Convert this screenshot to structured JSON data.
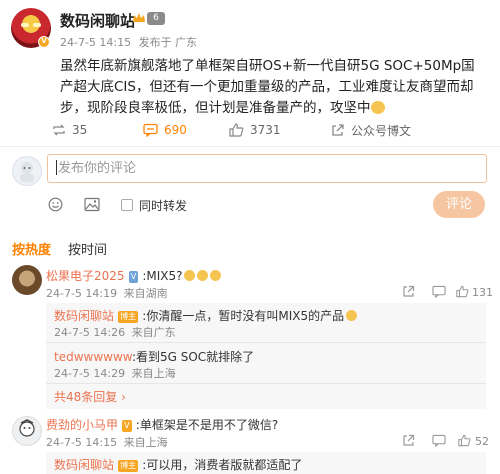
{
  "post": {
    "author": "数码闲聊站",
    "level": "6",
    "time": "24-7-5 14:15",
    "source": "发布于 广东",
    "text": "虽然年底新旗舰落地了单框架自研OS+新一代自研5G SOC+50Mp国产超大底CIS，但还有一个更加重量级的产品，工业难度让友商望而却步，现阶段良率极低，但计划是准备量产的，攻坚中"
  },
  "actions": {
    "repost": "35",
    "comment": "690",
    "like": "3731",
    "more": "公众号博文"
  },
  "composer": {
    "placeholder": "发布你的评论",
    "repost_label": "同时转发",
    "submit": "评论"
  },
  "tabs": {
    "hot": "按热度",
    "time": "按时间"
  },
  "comments": [
    {
      "user": "松果电子2025",
      "badge": "V",
      "text": ":MIX5?",
      "time": "24-7-5 14:19",
      "location": "来自湖南",
      "likes": "131",
      "replies": [
        {
          "user": "数码闲聊站",
          "badge": "博主",
          "text": ":你清醒一点，暂时没有叫MIX5的产品",
          "time": "24-7-5 14:26",
          "location": "来自广东"
        },
        {
          "user": "tedwwwwww",
          "text": ":看到5G SOC就排除了",
          "time": "24-7-5 14:29",
          "location": "来自上海"
        }
      ],
      "more_replies": "共48条回复"
    },
    {
      "user": "费劲的小马甲",
      "badge": "V",
      "text": ":单框架是不是用不了微信?",
      "time": "24-7-5 14:15",
      "location": "来自上海",
      "likes": "52",
      "replies": [
        {
          "user": "数码闲聊站",
          "badge": "博主",
          "text": ":可以用，消费者版就都适配了"
        }
      ]
    }
  ],
  "colors": {
    "accent": "#ff8200",
    "username": "#eb7350",
    "submit_disabled": "#f6c6a2"
  }
}
